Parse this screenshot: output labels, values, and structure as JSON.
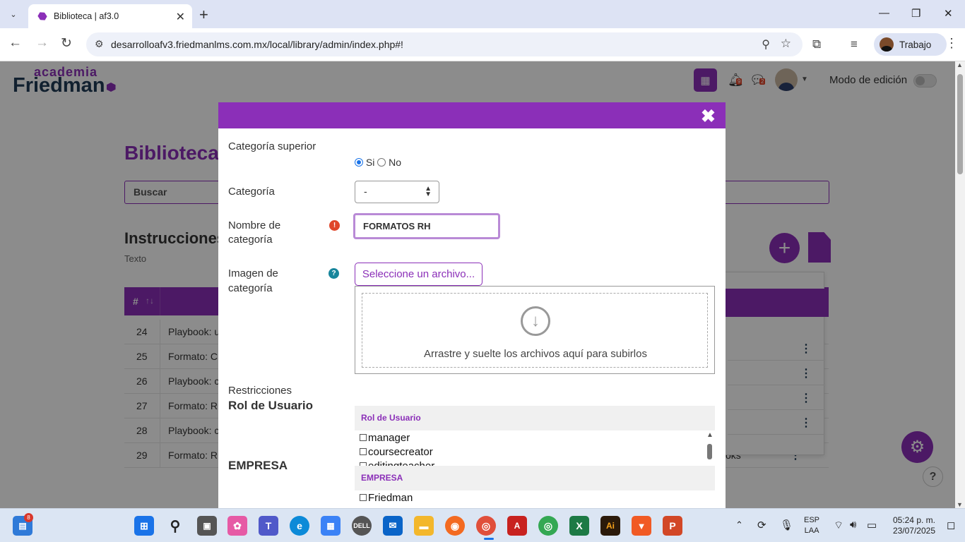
{
  "browser": {
    "tab_title": "Biblioteca | af3.0",
    "url": "desarrolloafv3.friedmanlms.com.mx/local/library/admin/index.php#!",
    "profile_label": "Trabajo"
  },
  "site": {
    "logo_top": "academia",
    "logo_main": "Friedman",
    "notifications_count": "9",
    "messages_count": "2",
    "edit_mode_label": "Modo de edición",
    "page_title": "Biblioteca",
    "search_placeholder": "Buscar",
    "section_title": "Instrucciones",
    "section_subtitle": "Texto",
    "table_header_num": "#",
    "rows": [
      {
        "num": "24",
        "name": "Playbook: u",
        "extra": ""
      },
      {
        "num": "25",
        "name": "Formato: C",
        "extra": ""
      },
      {
        "num": "26",
        "name": "Playbook: c",
        "extra": ""
      },
      {
        "num": "27",
        "name": "Formato: R",
        "extra": ""
      },
      {
        "num": "28",
        "name": "Playbook: c",
        "extra": "oks"
      },
      {
        "num": "29",
        "name": "Formato: R",
        "extra": "oks"
      }
    ]
  },
  "modal": {
    "parent_category_label": "Categoría superior",
    "radio_yes": "Si",
    "radio_no": "No",
    "radio_selected": "Si",
    "category_label": "Categoría",
    "category_value": "-",
    "name_label_line1": "Nombre de",
    "name_label_line2": "categoría",
    "name_value": "FORMATOS RH",
    "image_label_line1": "Imagen de",
    "image_label_line2": "categoría",
    "file_button": "Seleccione un archivo...",
    "dropzone_text": "Arrastre y suelte los archivos aquí para subirlos",
    "restrictions_label": "Restricciones",
    "role_label": "Rol de Usuario",
    "company_label": "EMPRESA",
    "role_box_header": "Rol de Usuario",
    "role_options": [
      "manager",
      "coursecreator",
      "editingteacher"
    ],
    "company_box_header": "EMPRESA",
    "company_options": [
      "Friedman"
    ]
  },
  "taskbar": {
    "widgets_badge": "8",
    "language_line1": "ESP",
    "language_line2": "LAA",
    "time": "05:24 p. m.",
    "date": "23/07/2025"
  },
  "colors": {
    "brand": "#8b2fb8",
    "brand_dark": "#1f3b57",
    "error": "#e0462a",
    "help": "#17859b"
  }
}
